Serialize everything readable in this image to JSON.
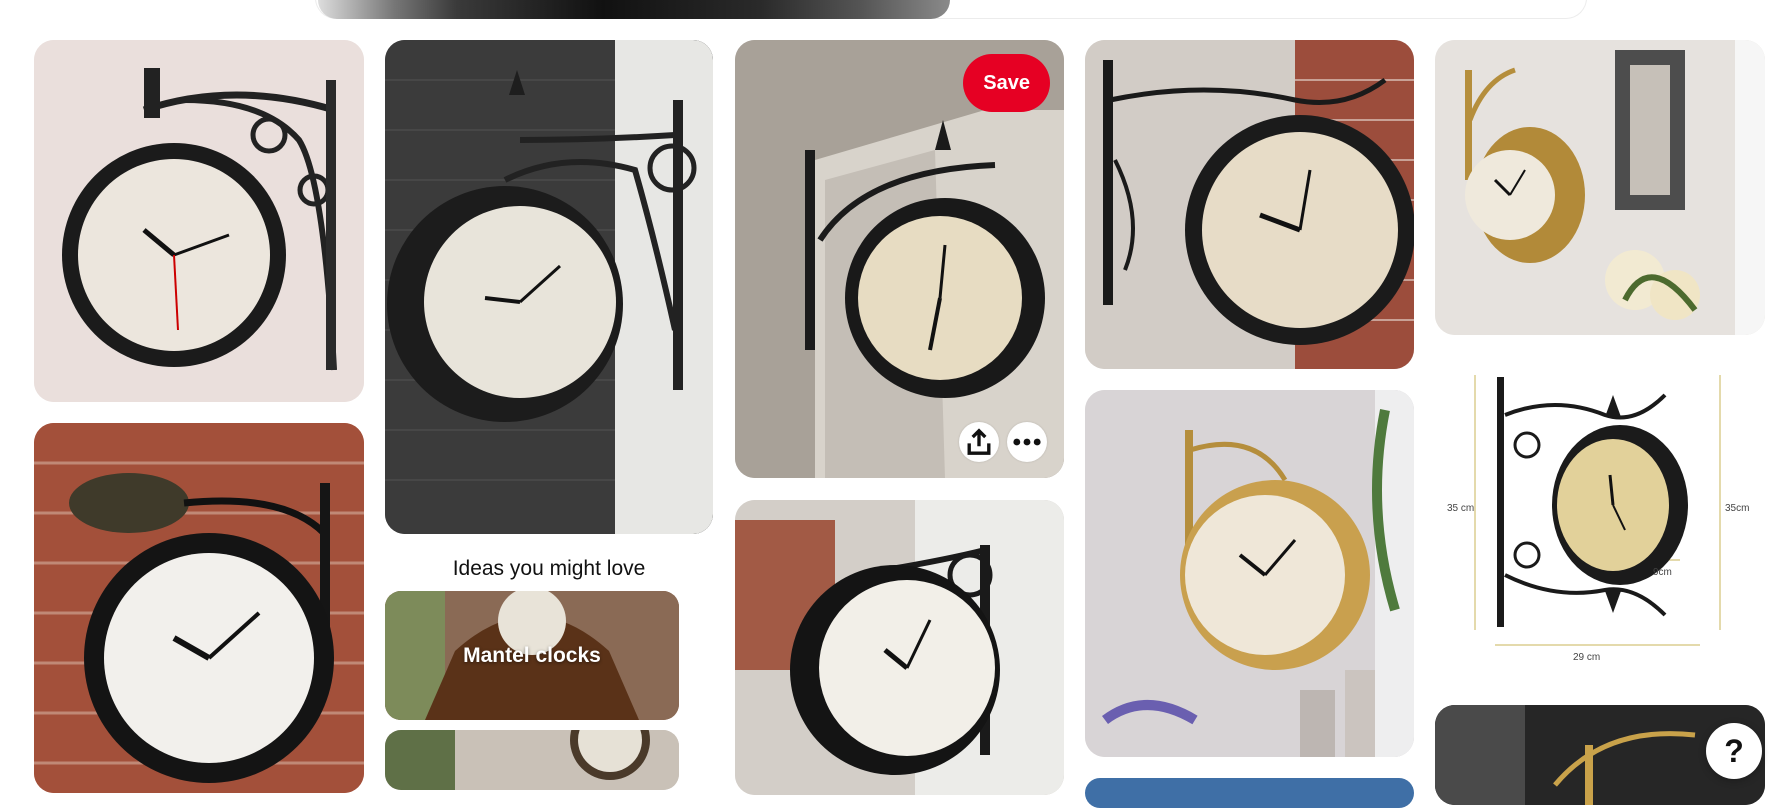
{
  "pin_actions": {
    "save_label": "Save",
    "share_icon": "share-icon",
    "more_icon": "more-icon"
  },
  "ideas": {
    "heading": "Ideas you might love",
    "cards": [
      {
        "label": "Mantel clocks"
      },
      {
        "label": ""
      }
    ]
  },
  "dimension_labels": {
    "height_left": "35 cm",
    "height_right": "35cm",
    "depth": "9cm",
    "width": "29 cm"
  },
  "help": {
    "label": "?"
  },
  "colors": {
    "brand_red": "#e60023"
  }
}
